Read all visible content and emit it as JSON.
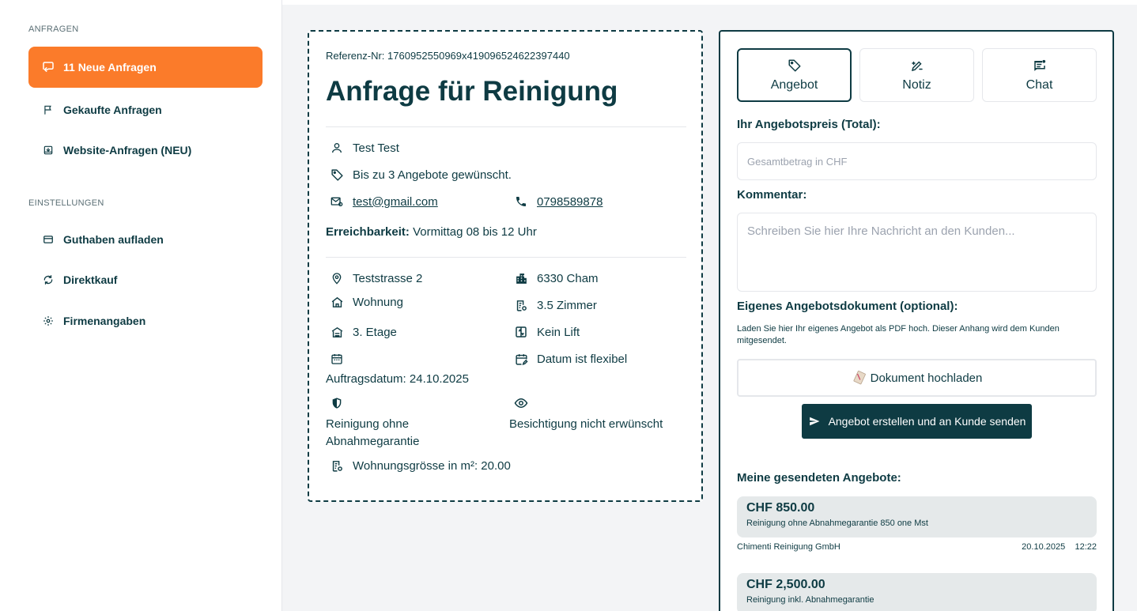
{
  "sidebar": {
    "section_requests": "ANFRAGEN",
    "section_settings": "EINSTELLUNGEN",
    "items": [
      {
        "label": "11 Neue Anfragen",
        "icon": "chat-arrow-icon"
      },
      {
        "label": "Gekaufte Anfragen",
        "icon": "flag-icon"
      },
      {
        "label": "Website-Anfragen (NEU)",
        "icon": "inbox-icon"
      },
      {
        "label": "Guthaben aufladen",
        "icon": "credit-card-icon"
      },
      {
        "label": "Direktkauf",
        "icon": "refresh-icon"
      },
      {
        "label": "Firmenangaben",
        "icon": "gear-icon"
      }
    ]
  },
  "request": {
    "reference": "Referenz-Nr: 1760952550969x419096524622397440",
    "title": "Anfrage für Reinigung",
    "name": "Test Test",
    "offers_wanted": "Bis zu 3 Angebote gewünscht.",
    "email": "test@gmail.com",
    "phone": "0798589878",
    "availability_label": "Erreichbarkeit:",
    "availability_value": "Vormittag 08 bis 12 Uhr",
    "street": "Teststrasse 2",
    "city": "6330 Cham",
    "property_type": "Wohnung",
    "rooms": "3.5 Zimmer",
    "floor": "3. Etage",
    "lift": "Kein Lift",
    "order_date": "Auftragsdatum: 24.10.2025",
    "date_flexible": "Datum ist flexibel",
    "guarantee": "Reinigung ohne Abnahmegarantie",
    "inspection": "Besichtigung nicht erwünscht",
    "size": "Wohnungsgrösse in m²: 20.00"
  },
  "offer_panel": {
    "tabs": [
      {
        "label": "Angebot",
        "icon": "tag-icon"
      },
      {
        "label": "Notiz",
        "icon": "pencil-note-icon"
      },
      {
        "label": "Chat",
        "icon": "chat-icon"
      }
    ],
    "price_label": "Ihr Angebotspreis (Total):",
    "price_placeholder": "Gesamtbetrag in CHF",
    "comment_label": "Kommentar:",
    "comment_placeholder": "Schreiben Sie hier Ihre Nachricht an den Kunden...",
    "doc_label": "Eigenes Angebotsdokument (optional):",
    "doc_help": "Laden Sie hier Ihr eigenes Angebot als PDF hoch. Dieser Anhang wird dem Kunden mitgesendet.",
    "upload_label": "Dokument hochladen",
    "send_label": "Angebot erstellen und an Kunde senden",
    "sent_title": "Meine gesendeten Angebote:",
    "sent_offers": [
      {
        "price": "CHF 850.00",
        "desc": "Reinigung ohne Abnahmegarantie 850 one Mst",
        "company": "Chimenti Reinigung GmbH",
        "date": "20.10.2025",
        "time": "12:22"
      },
      {
        "price": "CHF 2,500.00",
        "desc": "Reinigung inkl. Abnahmegarantie"
      }
    ]
  },
  "colors": {
    "accent": "#fb7b2a",
    "primary": "#0e3b43"
  }
}
